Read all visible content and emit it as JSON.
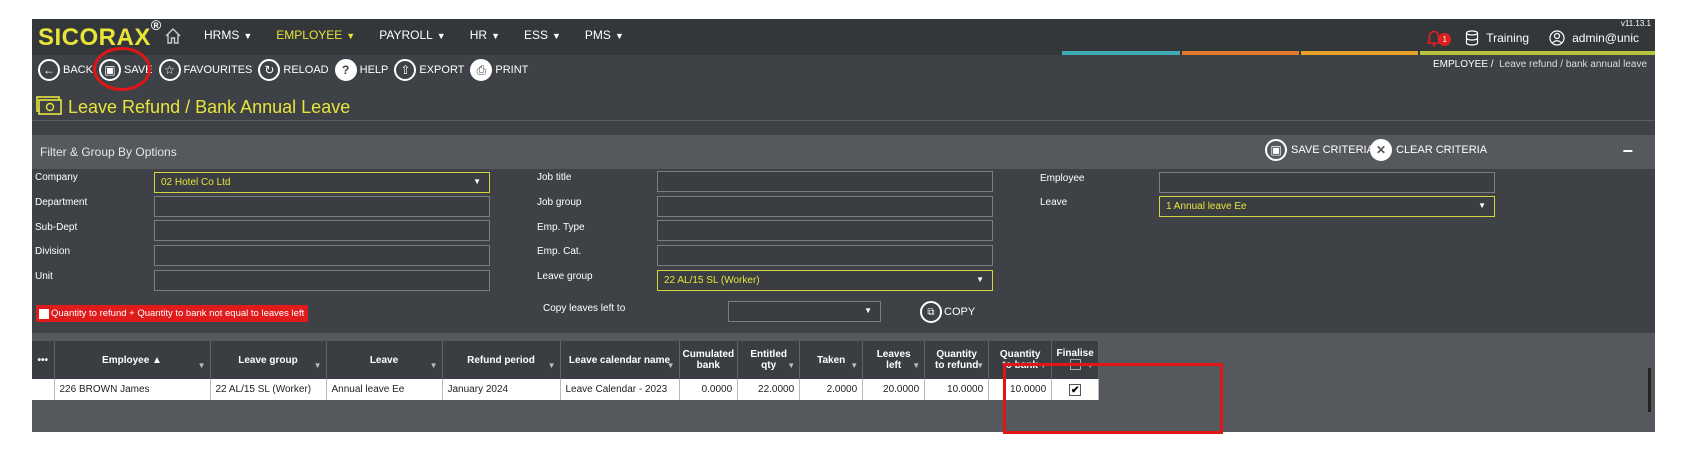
{
  "app": {
    "logo": "SICORAX",
    "logo_mark": "®",
    "version": "v11.13.1"
  },
  "menu": [
    {
      "label": "HRMS",
      "active": false
    },
    {
      "label": "EMPLOYEE",
      "active": true
    },
    {
      "label": "PAYROLL",
      "active": false
    },
    {
      "label": "HR",
      "active": false
    },
    {
      "label": "ESS",
      "active": false
    },
    {
      "label": "PMS",
      "active": false
    }
  ],
  "topright": {
    "notifications": "1",
    "database": "Training",
    "user": "admin@unic"
  },
  "toolbar": {
    "back": "BACK",
    "save": "SAVE",
    "favourites": "FAVOURITES",
    "reload": "RELOAD",
    "help": "HELP",
    "export": "EXPORT",
    "print": "PRINT"
  },
  "breadcrumb": {
    "root": "EMPLOYEE /",
    "current": "Leave refund / bank annual leave"
  },
  "page_title": "Leave Refund / Bank Annual Leave",
  "filter": {
    "title": "Filter & Group By Options",
    "save_criteria": "SAVE CRITERIA",
    "clear_criteria": "CLEAR CRITERIA",
    "collapse": "−",
    "labels": {
      "company": "Company",
      "department": "Department",
      "subdept": "Sub-Dept",
      "division": "Division",
      "unit": "Unit",
      "jobtitle": "Job title",
      "jobgroup": "Job group",
      "emptype": "Emp. Type",
      "empcat": "Emp. Cat.",
      "leavegroup": "Leave group",
      "employee": "Employee",
      "leave": "Leave",
      "copyleaves": "Copy leaves left to"
    },
    "values": {
      "company": "02 Hotel Co Ltd",
      "leavegroup": "22 AL/15 SL (Worker)",
      "leave": "1 Annual leave Ee"
    },
    "warning": "Quantity to refund + Quantity to bank not equal to leaves left",
    "copy": "COPY"
  },
  "grid": {
    "menu": "•••",
    "columns": {
      "employee": "Employee ▲",
      "leavegroup": "Leave group",
      "leave": "Leave",
      "refund": "Refund period",
      "calendar": "Leave calendar name",
      "cumulated1": "Cumulated",
      "cumulated2": "bank",
      "entitled1": "Entitled",
      "entitled2": "qty",
      "taken": "Taken",
      "leavesleft1": "Leaves",
      "leavesleft2": "left",
      "qtyrefund1": "Quantity",
      "qtyrefund2": "to refund",
      "qtybank1": "Quantity",
      "qtybank2": "to bank",
      "finalise": "Finalise"
    },
    "rows": [
      {
        "employee": "226 BROWN James",
        "leavegroup": "22 AL/15 SL (Worker)",
        "leave": "Annual leave Ee",
        "refund": "January 2024",
        "calendar": "Leave Calendar - 2023",
        "cumulated": "0.0000",
        "entitled": "22.0000",
        "taken": "2.0000",
        "leavesleft": "20.0000",
        "qtyrefund": "10.0000",
        "qtybank": "10.0000",
        "finalise": "✔"
      }
    ]
  },
  "colors": {
    "accent": "#e8e43a",
    "background": "#3e4246",
    "topbar": "#33373a",
    "highlight": "#e01515",
    "stripes": [
      "#3fa9b5",
      "#e07a2a",
      "#e8a22a",
      "#b5c23a"
    ]
  }
}
